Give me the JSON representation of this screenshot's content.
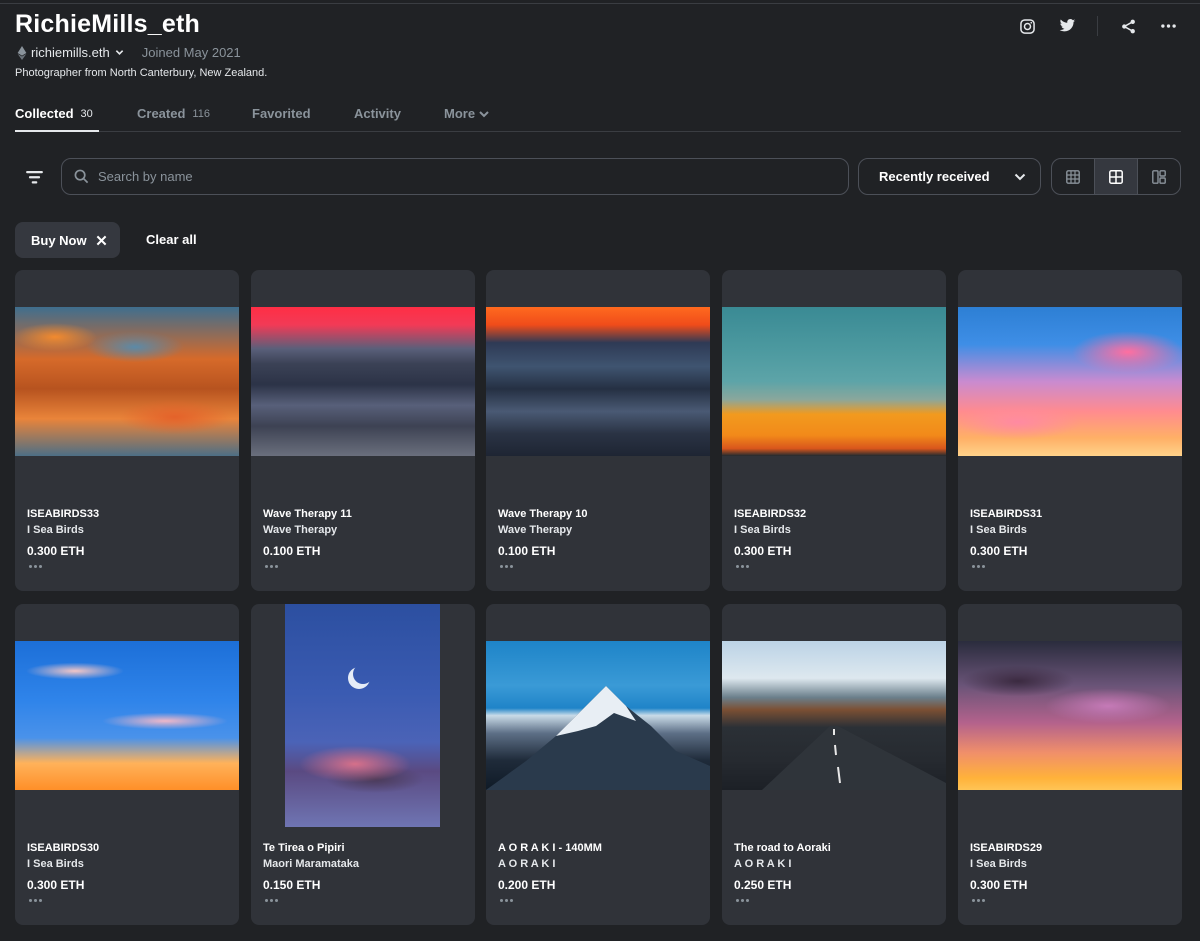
{
  "profile": {
    "title": "RichieMills_eth",
    "ens": "richiemills.eth",
    "joined": "Joined May 2021",
    "bio": "Photographer from North Canterbury, New Zealand."
  },
  "header_icons": [
    "instagram-icon",
    "twitter-icon",
    "share-icon",
    "more-icon"
  ],
  "tabs": [
    {
      "label": "Collected",
      "count": "30",
      "active": true
    },
    {
      "label": "Created",
      "count": "116"
    },
    {
      "label": "Favorited",
      "count": ""
    },
    {
      "label": "Activity",
      "count": ""
    },
    {
      "label": "More",
      "count": ""
    }
  ],
  "search": {
    "placeholder": "Search by name",
    "value": ""
  },
  "sort": {
    "label": "Recently received"
  },
  "view_modes": [
    "grid-large-icon",
    "grid-medium-icon",
    "grid-dense-icon"
  ],
  "active_view": 1,
  "filters": {
    "chip": "Buy Now",
    "clear_label": "Clear all"
  },
  "items": [
    {
      "name": "ISEABIRDS33",
      "collection": "I Sea Birds",
      "price": "0.300 ETH"
    },
    {
      "name": "Wave Therapy 11",
      "collection": "Wave Therapy",
      "price": "0.100 ETH"
    },
    {
      "name": "Wave Therapy 10",
      "collection": "Wave Therapy",
      "price": "0.100 ETH"
    },
    {
      "name": "ISEABIRDS32",
      "collection": "I Sea Birds",
      "price": "0.300 ETH"
    },
    {
      "name": "ISEABIRDS31",
      "collection": "I Sea Birds",
      "price": "0.300 ETH"
    },
    {
      "name": "ISEABIRDS30",
      "collection": "I Sea Birds",
      "price": "0.300 ETH"
    },
    {
      "name": "Te Tirea o Pipiri",
      "collection": "Maori Maramataka",
      "price": "0.150 ETH"
    },
    {
      "name": "A O R A K I - 140MM",
      "collection": "A O R A K I",
      "price": "0.200 ETH"
    },
    {
      "name": "The road to Aoraki",
      "collection": "A O R A K I",
      "price": "0.250 ETH"
    },
    {
      "name": "ISEABIRDS29",
      "collection": "I Sea Birds",
      "price": "0.300 ETH"
    }
  ],
  "colors": {
    "background": "#202225",
    "card": "#303339",
    "border": "#4c5058",
    "muted": "#8a939b"
  }
}
